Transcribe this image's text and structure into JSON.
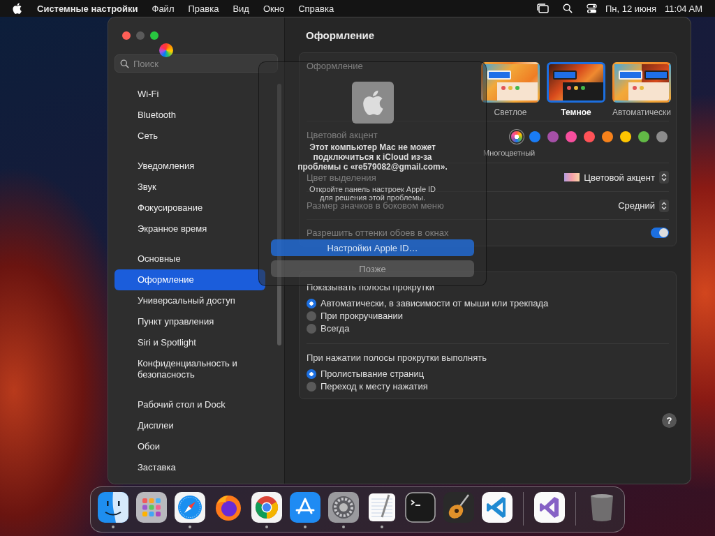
{
  "menu_bar": {
    "app_name": "Системные настройки",
    "menus": [
      "Файл",
      "Правка",
      "Вид",
      "Окно",
      "Справка"
    ],
    "date": "Пн, 12 июня",
    "time": "11:04 AM"
  },
  "sidebar": {
    "search": {
      "placeholder": "Поиск"
    },
    "groups": [
      [
        {
          "label": "Wi-Fi",
          "selected": false
        },
        {
          "label": "Bluetooth",
          "selected": false
        },
        {
          "label": "Сеть",
          "selected": false
        }
      ],
      [
        {
          "label": "Уведомления",
          "selected": false
        },
        {
          "label": "Звук",
          "selected": false
        },
        {
          "label": "Фокусирование",
          "selected": false
        },
        {
          "label": "Экранное время",
          "selected": false
        }
      ],
      [
        {
          "label": "Основные",
          "selected": false
        },
        {
          "label": "Оформление",
          "selected": true
        },
        {
          "label": "Универсальный доступ",
          "selected": false
        },
        {
          "label": "Пункт управления",
          "selected": false
        },
        {
          "label": "Siri и Spotlight",
          "selected": false
        },
        {
          "label": "Конфиденциальность и безопасность",
          "selected": false
        }
      ],
      [
        {
          "label": "Рабочий стол и Dock",
          "selected": false
        },
        {
          "label": "Дисплеи",
          "selected": false
        },
        {
          "label": "Обои",
          "selected": false
        },
        {
          "label": "Заставка",
          "selected": false
        }
      ]
    ]
  },
  "content": {
    "title": "Оформление",
    "appearance": {
      "label": "Оформление",
      "options": [
        {
          "label": "Светлое",
          "kind": "light",
          "selected": false
        },
        {
          "label": "Темное",
          "kind": "dark",
          "selected": true
        },
        {
          "label": "Автоматически",
          "kind": "auto",
          "selected": false
        }
      ]
    },
    "accent": {
      "label": "Цветовой акцент",
      "caption": "Многоцветный",
      "colors": [
        {
          "kind": "multicolor",
          "selected": true
        },
        {
          "kind": "solid",
          "color": "#1a7cf5",
          "selected": false
        },
        {
          "kind": "solid",
          "color": "#a550a7",
          "selected": false
        },
        {
          "kind": "solid",
          "color": "#f74f9e",
          "selected": false
        },
        {
          "kind": "solid",
          "color": "#ff5257",
          "selected": false
        },
        {
          "kind": "solid",
          "color": "#f7821b",
          "selected": false
        },
        {
          "kind": "solid",
          "color": "#ffc600",
          "selected": false
        },
        {
          "kind": "solid",
          "color": "#62ba46",
          "selected": false
        },
        {
          "kind": "solid",
          "color": "#8c8c8c",
          "selected": false
        }
      ]
    },
    "highlight": {
      "label": "Цвет выделения",
      "value": "Цветовой акцент"
    },
    "icon_size": {
      "label": "Размер значков в боковом меню",
      "value": "Средний"
    },
    "wallpaper_tint": {
      "label": "Разрешить оттенки обоев в окнах",
      "on": true
    },
    "scroll_bars": {
      "label": "Показывать полосы прокрутки",
      "options": [
        {
          "label": "Автоматически, в зависимости от мыши или трекпада",
          "selected": true
        },
        {
          "label": "При прокручивании",
          "selected": false
        },
        {
          "label": "Всегда",
          "selected": false
        }
      ]
    },
    "click_scroll": {
      "label": "При нажатии полосы прокрутки выполнять",
      "options": [
        {
          "label": "Пролистывание страниц",
          "selected": true
        },
        {
          "label": "Переход к месту нажатия",
          "selected": false
        }
      ]
    },
    "help": "?"
  },
  "dialog": {
    "title": "Этот компьютер Mac не может подключиться к iCloud из-за проблемы с «re579082@gmail.com».",
    "message": "Откройте панель настроек Apple ID для решения этой проблемы.",
    "buttons": [
      {
        "label": "Настройки Apple ID…",
        "kind": "primary"
      },
      {
        "label": "Позже",
        "kind": "secondary"
      }
    ]
  },
  "dock": {
    "groups": [
      [
        {
          "kind": "finder",
          "running": true
        },
        {
          "kind": "launchpad",
          "running": false
        },
        {
          "kind": "safari",
          "running": true
        },
        {
          "kind": "firefox",
          "running": false
        },
        {
          "kind": "chrome",
          "running": true
        },
        {
          "kind": "appstore",
          "running": true
        },
        {
          "kind": "settings",
          "running": true
        },
        {
          "kind": "textedit",
          "running": true
        },
        {
          "kind": "terminal",
          "running": false
        },
        {
          "kind": "garageband",
          "running": false
        },
        {
          "kind": "vscode",
          "running": false
        }
      ],
      [
        {
          "kind": "visualstudio",
          "running": false
        }
      ],
      [
        {
          "kind": "trash",
          "running": false
        }
      ]
    ]
  }
}
